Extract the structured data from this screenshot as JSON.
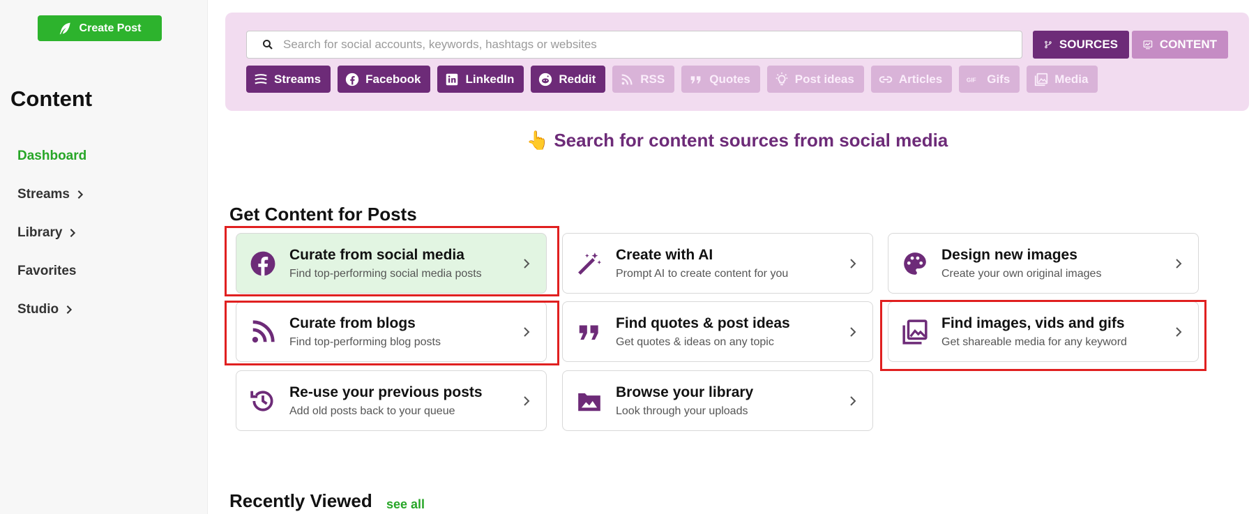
{
  "sidebar": {
    "create_post": "Create Post",
    "title": "Content",
    "items": [
      {
        "label": "Dashboard",
        "active": true,
        "chevron": false
      },
      {
        "label": "Streams",
        "chevron": true
      },
      {
        "label": "Library",
        "chevron": true
      },
      {
        "label": "Favorites",
        "chevron": false
      },
      {
        "label": "Studio",
        "chevron": true
      }
    ]
  },
  "search": {
    "placeholder": "Search for social accounts, keywords, hashtags or websites",
    "sources_label": "SOURCES",
    "content_label": "CONTENT"
  },
  "chips": [
    {
      "label": "Streams",
      "icon": "streams-icon",
      "active": true
    },
    {
      "label": "Facebook",
      "icon": "facebook-icon",
      "active": true
    },
    {
      "label": "LinkedIn",
      "icon": "linkedin-icon",
      "active": true
    },
    {
      "label": "Reddit",
      "icon": "reddit-icon",
      "active": true
    },
    {
      "label": "RSS",
      "icon": "rss-icon",
      "active": false
    },
    {
      "label": "Quotes",
      "icon": "quote-icon",
      "active": false
    },
    {
      "label": "Post ideas",
      "icon": "lightbulb-icon",
      "active": false
    },
    {
      "label": "Articles",
      "icon": "link-icon",
      "active": false
    },
    {
      "label": "Gifs",
      "icon": "gif-icon",
      "active": false
    },
    {
      "label": "Media",
      "icon": "media-icon",
      "active": false
    }
  ],
  "hint": {
    "emoji": "👆",
    "text": "Search for content sources from social media"
  },
  "section_title": "Get Content for Posts",
  "cards": [
    {
      "title": "Curate from social media",
      "subtitle": "Find top-performing social media posts",
      "icon": "facebook-icon"
    },
    {
      "title": "Create with AI",
      "subtitle": "Prompt AI to create content for you",
      "icon": "magic-wand-icon"
    },
    {
      "title": "Design new images",
      "subtitle": "Create your own original images",
      "icon": "palette-icon"
    },
    {
      "title": "Curate from blogs",
      "subtitle": "Find top-performing blog posts",
      "icon": "rss-icon"
    },
    {
      "title": "Find quotes & post ideas",
      "subtitle": "Get quotes & ideas on any topic",
      "icon": "quote-icon"
    },
    {
      "title": "Find images, vids and gifs",
      "subtitle": "Get shareable media for any keyword",
      "icon": "media-icon"
    },
    {
      "title": "Re-use your previous posts",
      "subtitle": "Add old posts back to your queue",
      "icon": "history-icon"
    },
    {
      "title": "Browse your library",
      "subtitle": "Look through your uploads",
      "icon": "image-icon"
    }
  ],
  "recent": {
    "title": "Recently Viewed",
    "see_all": "see all"
  },
  "colors": {
    "brand_purple": "#6d2b78",
    "brand_green": "#2db32d",
    "panel_pink": "#f2dcf0",
    "highlight_red": "#e02020"
  }
}
